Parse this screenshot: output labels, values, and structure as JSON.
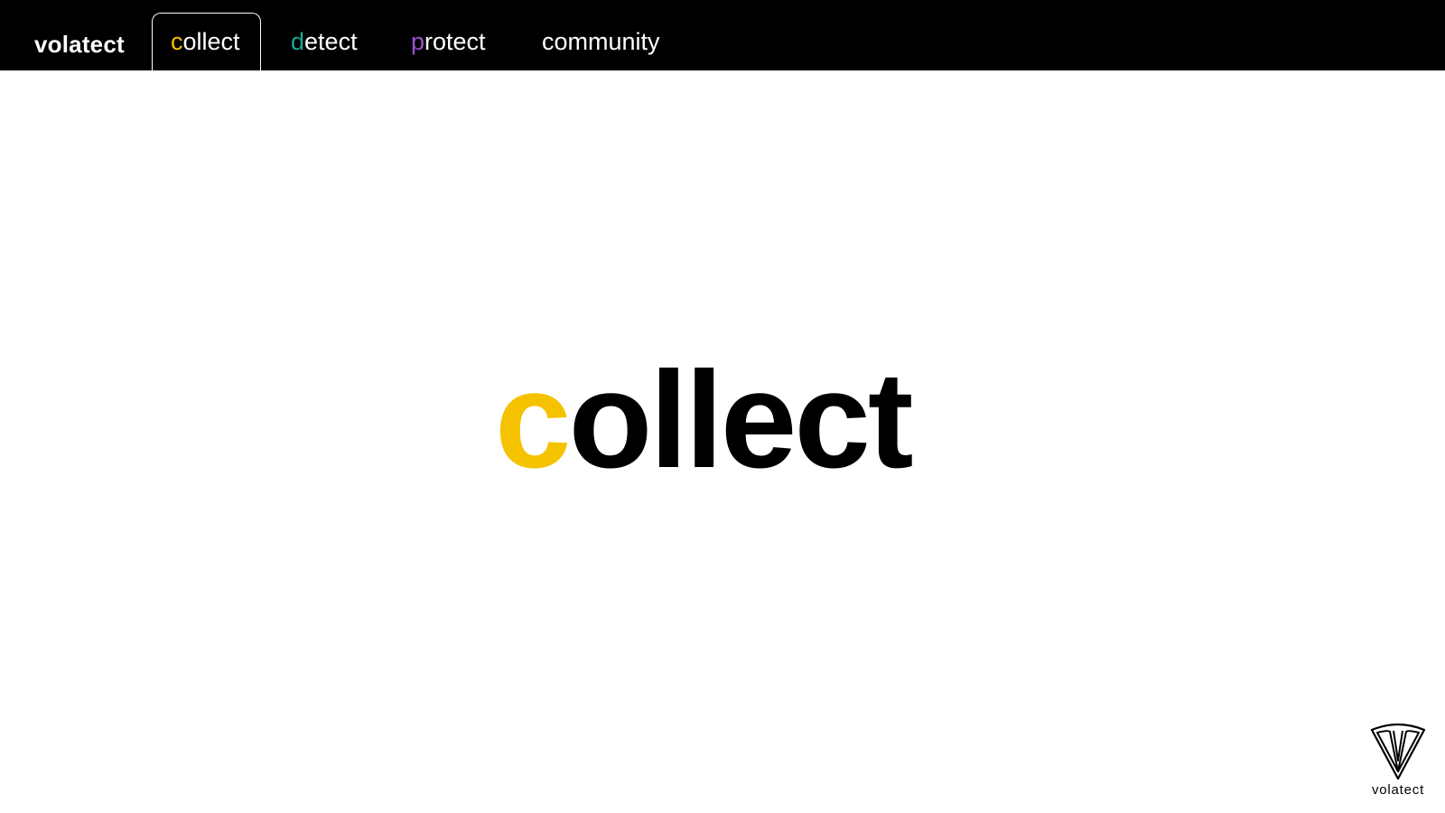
{
  "nav": {
    "brand": "volatect",
    "tabs": [
      {
        "first": "c",
        "rest": "ollect",
        "accent": "#f5c200",
        "active": true
      },
      {
        "first": "d",
        "rest": "etect",
        "accent": "#1aa88e",
        "active": false
      },
      {
        "first": "p",
        "rest": "rotect",
        "accent": "#9b4fd1",
        "active": false
      },
      {
        "first": "",
        "rest": "community",
        "accent": "#ffffff",
        "active": false
      }
    ]
  },
  "hero": {
    "first": "c",
    "rest": "ollect",
    "accent": "#f5c200"
  },
  "footer": {
    "logo_icon": "shield-icon",
    "logo_text": "volatect"
  },
  "colors": {
    "navbar_bg": "#000000",
    "page_bg": "#ffffff",
    "text_dark": "#000000",
    "text_light": "#ffffff"
  }
}
